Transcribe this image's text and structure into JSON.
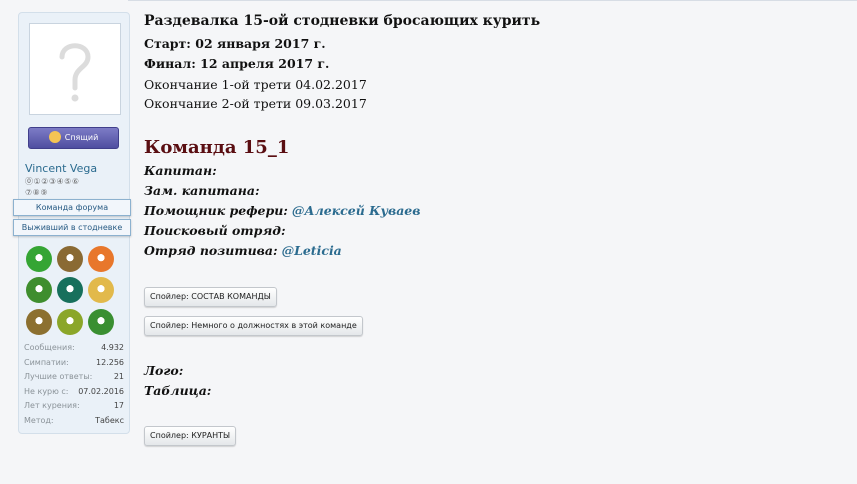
{
  "profile": {
    "status": "Спящий",
    "username": "Vincent Vega",
    "trophy_rows": [
      "⓪①②③④⑤⑥",
      "⑦⑧⑨"
    ],
    "ribbons": [
      "Команда форума",
      "Выживший в стодневке"
    ],
    "stats": [
      {
        "label": "Сообщения:",
        "value": "4.932"
      },
      {
        "label": "Симпатии:",
        "value": "12.256"
      },
      {
        "label": "Лучшие ответы:",
        "value": "21"
      },
      {
        "label": "Не курю с:",
        "value": "07.02.2016"
      },
      {
        "label": "Лет курения:",
        "value": "17"
      },
      {
        "label": "Метод:",
        "value": "Табекс"
      }
    ],
    "medal_colors": [
      "#35a534",
      "#8a6a33",
      "#e8772b",
      "#3f8e2e",
      "#17705c",
      "#e2b94b",
      "#8c7030",
      "#8ba629",
      "#3a8f31"
    ]
  },
  "post": {
    "title": "Раздевалка 15-ой стодневки бросающих курить",
    "start": "Старт: 02 января 2017 г.",
    "finish": "Финал: 12 апреля 2017 г.",
    "third1": "Окончание 1-ой трети 04.02.2017",
    "third2": "Окончание 2-ой трети 09.03.2017",
    "team": "Команда 15_1",
    "captain_label": "Капитан:",
    "vice_label": "Зам. капитана:",
    "referee_label": "Помощник рефери:",
    "referee_value": "@Алексей Куваев",
    "search_label": "Поисковый отряд:",
    "positive_label": "Отряд позитива:",
    "positive_value": "@Leticia",
    "logo_label": "Лого:",
    "table_label": "Таблица:",
    "spoilers": [
      "Спойлер: СОСТАВ КОМАНДЫ",
      "Спойлер: Немного о должностях в этой команде",
      "Спойлер: КУРАНТЫ"
    ]
  }
}
